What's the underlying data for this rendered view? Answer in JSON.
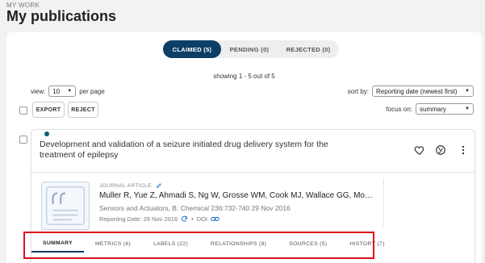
{
  "header": {
    "kicker": "MY WORK",
    "title": "My publications"
  },
  "status_tabs": [
    {
      "label": "CLAIMED (5)",
      "active": true
    },
    {
      "label": "PENDING (0)",
      "active": false
    },
    {
      "label": "REJECTED (0)",
      "active": false
    }
  ],
  "showing": "showing 1 - 5 out of 5",
  "view": {
    "label": "view:",
    "value": "10",
    "suffix": "per page"
  },
  "sort": {
    "label": "sort by:",
    "value": "Reporting date (newest first)"
  },
  "focus": {
    "label": "focus on:",
    "value": "summary"
  },
  "actions": {
    "export": "EXPORT",
    "reject": "REJECT"
  },
  "publication": {
    "title": "Development and validation of a seizure initiated drug delivery system for the treatment of epilepsy",
    "type": "JOURNAL ARTICLE",
    "authors": "Muller R, Yue Z, Ahmadi S, Ng W, Grosse WM, Cook MJ, Wallace GG, Mou...",
    "citation": "Sensors and Actuators, B: Chemical 236:732-740 29 Nov 2016",
    "reporting_date": "Reporting Date: 29 Nov 2016",
    "separator": "•",
    "doi": "DOI"
  },
  "subtabs": [
    {
      "label": "SUMMARY",
      "active": true
    },
    {
      "label": "METRICS (6)"
    },
    {
      "label": "LABELS (22)"
    },
    {
      "label": "RELATIONSHIPS (8)"
    },
    {
      "label": "SOURCES (5)"
    },
    {
      "label": "HISTORY (7)"
    }
  ],
  "colors": {
    "accent": "#0d3f66",
    "highlight": "#e0101a",
    "status_dot": "#0d5e6e"
  }
}
